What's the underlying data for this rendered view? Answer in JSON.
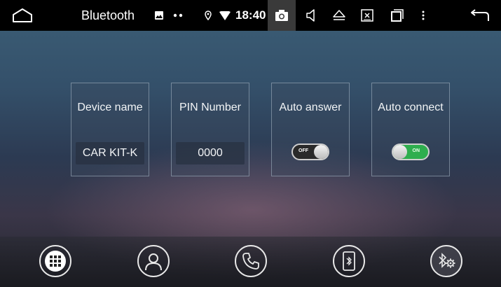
{
  "statusbar": {
    "title": "Bluetooth",
    "time": "18:40",
    "icons": [
      "home-icon",
      "image-icon",
      "dots-icon",
      "location-icon",
      "wifi-icon",
      "camera-icon",
      "volume-icon",
      "eject-icon",
      "close-box-icon",
      "recent-apps-icon",
      "more-icon",
      "back-icon"
    ]
  },
  "settings": {
    "device_name": {
      "label": "Device name",
      "value": "CAR KIT-K"
    },
    "pin_number": {
      "label": "PIN Number",
      "value": "0000"
    },
    "auto_answer": {
      "label": "Auto answer",
      "state": "OFF",
      "on": false
    },
    "auto_connect": {
      "label": "Auto connect",
      "state": "ON",
      "on": true
    }
  },
  "dock": {
    "buttons": [
      "apps-grid-icon",
      "contacts-icon",
      "phone-icon",
      "bluetooth-phone-icon",
      "bluetooth-settings-icon"
    ]
  },
  "colors": {
    "toggle_on": "#2eae4e",
    "toggle_off": "#2a2a2a",
    "statusbar": "#000000"
  }
}
